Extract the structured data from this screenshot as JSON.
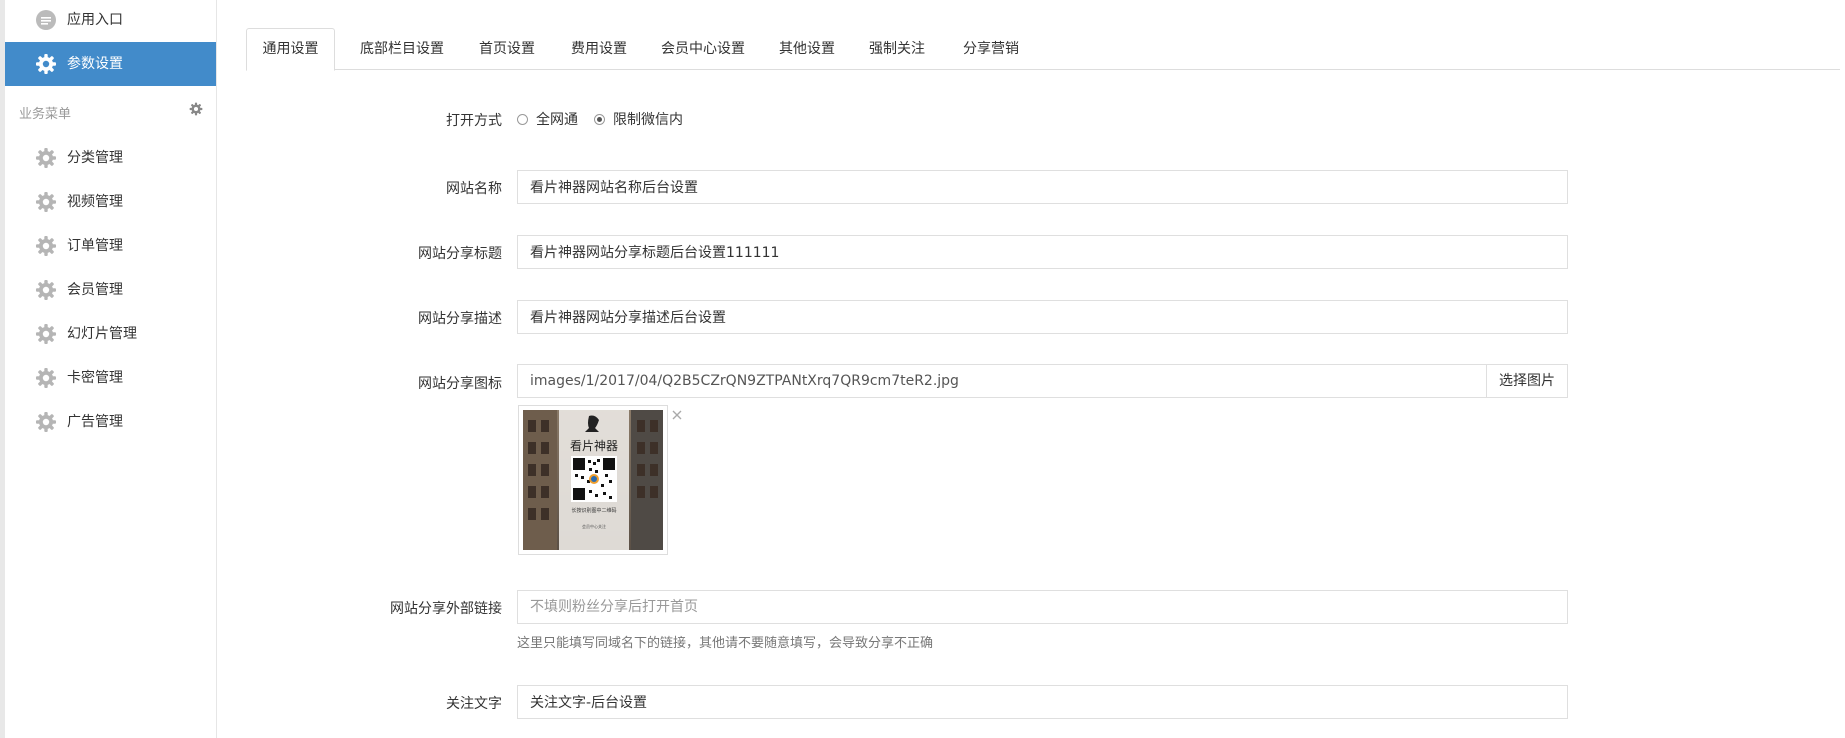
{
  "sidebar": {
    "top_items": [
      {
        "label": "应用入口",
        "icon": "chat-icon"
      },
      {
        "label": "参数设置",
        "icon": "gear-icon",
        "active": true
      }
    ],
    "group_label": "业务菜单",
    "group_icon": "gear-icon",
    "items": [
      {
        "label": "分类管理",
        "icon": "gear-icon"
      },
      {
        "label": "视频管理",
        "icon": "gear-icon"
      },
      {
        "label": "订单管理",
        "icon": "gear-icon"
      },
      {
        "label": "会员管理",
        "icon": "gear-icon"
      },
      {
        "label": "幻灯片管理",
        "icon": "gear-icon"
      },
      {
        "label": "卡密管理",
        "icon": "gear-icon"
      },
      {
        "label": "广告管理",
        "icon": "gear-icon"
      }
    ]
  },
  "tabs": [
    {
      "label": "通用设置",
      "active": true
    },
    {
      "label": "底部栏目设置"
    },
    {
      "label": "首页设置"
    },
    {
      "label": "费用设置"
    },
    {
      "label": "会员中心设置"
    },
    {
      "label": "其他设置"
    },
    {
      "label": "强制关注"
    },
    {
      "label": "分享营销"
    }
  ],
  "form": {
    "open_mode": {
      "label": "打开方式",
      "options": [
        {
          "label": "全网通",
          "checked": false
        },
        {
          "label": "限制微信内",
          "checked": true
        }
      ]
    },
    "site_name": {
      "label": "网站名称",
      "value": "看片神器网站名称后台设置"
    },
    "share_title": {
      "label": "网站分享标题",
      "value": "看片神器网站分享标题后台设置111111"
    },
    "share_desc": {
      "label": "网站分享描述",
      "value": "看片神器网站分享描述后台设置"
    },
    "share_icon": {
      "label": "网站分享图标",
      "value": "images/1/2017/04/Q2B5CZrQN9ZTPANtXrq7QR9cm7teR2.jpg",
      "button": "选择图片",
      "preview_title": "看片神器",
      "preview_caption": "长按识别图中二维码",
      "preview_footer": "会员中心关注"
    },
    "share_link": {
      "label": "网站分享外部链接",
      "value": "",
      "placeholder": "不填则粉丝分享后打开首页",
      "help": "这里只能填写同域名下的链接，其他请不要随意填写，会导致分享不正确"
    },
    "follow_text": {
      "label": "关注文字",
      "value": "关注文字-后台设置"
    }
  },
  "colors": {
    "accent": "#428bca",
    "border": "#dfdfdf",
    "muted": "#999999"
  }
}
